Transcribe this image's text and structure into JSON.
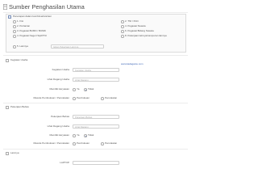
{
  "title": "Sumber Penghasilan Utama",
  "section_main": {
    "header": "Penerapan dalam kombinasi/variasi",
    "options_left": [
      "1. Fisi",
      "2. Pertanian",
      "3. Pegawai BUMN / BUMD",
      "4. Pegawai Negeri Sipil/TNI",
      "5. Lainnya"
    ],
    "options_right": [
      "2. TNI / Polri",
      "4. Pegawai Swasta",
      "6. Pegawai Bidang Swasta",
      "8. Pekerjaan lainnya/campuran lainnya"
    ],
    "lainnya_placeholder": "Isikan Pekerjaan Lainnya"
  },
  "section_kegiatan": {
    "checkbox_label": "Kegiatan Usaha",
    "url_text": "www.kadaganie.com",
    "fields": [
      {
        "label": "Kegiatan Usaha",
        "placeholder": "Kegiatan Usaha"
      },
      {
        "label": "Lihat Dagang Usaha",
        "placeholder": "Lihat Dagang"
      },
      {
        "label": "Memiliki karyawan",
        "radio_yes": "Ya",
        "radio_no": "Tidak"
      },
      {
        "label": "Metode Pembukuan / Pencatatan",
        "option_a": "Pembukuan",
        "option_b": "Pencatatan"
      }
    ]
  },
  "section_pekerjaan": {
    "checkbox_label": "Pekerjaan Bebas",
    "fields": [
      {
        "label": "Pekerjaan Bebas",
        "placeholder": "Pekerjaan Bebas"
      },
      {
        "label": "Lihat Dagang Usaha",
        "placeholder": "Lihat Dagang"
      },
      {
        "label": "Memiliki karyawan",
        "radio_yes": "Ya",
        "radio_no": "Tidak"
      },
      {
        "label": "Metode Pembukuan / Pencatatan",
        "option_a": "Pembukuan",
        "option_b": "Pencatatan"
      }
    ]
  },
  "section_lainnya": {
    "checkbox_label": "Lainnya",
    "field_label": "LAPTOP"
  }
}
